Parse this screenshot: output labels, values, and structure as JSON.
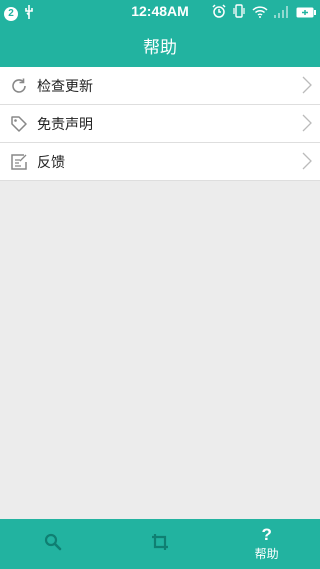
{
  "status_bar": {
    "time": "12:48AM",
    "notification_count": "2"
  },
  "header": {
    "title": "帮助"
  },
  "menu": {
    "items": [
      {
        "label": "检查更新",
        "icon": "refresh-icon"
      },
      {
        "label": "免责声明",
        "icon": "tag-icon"
      },
      {
        "label": "反馈",
        "icon": "edit-note-icon"
      }
    ]
  },
  "tabbar": {
    "tabs": [
      {
        "icon": "search-icon",
        "label": ""
      },
      {
        "icon": "crop-icon",
        "label": ""
      },
      {
        "icon": "help-icon",
        "label": "帮助",
        "glyph": "?"
      }
    ]
  },
  "colors": {
    "accent": "#22b3a0",
    "background": "#ececec"
  }
}
